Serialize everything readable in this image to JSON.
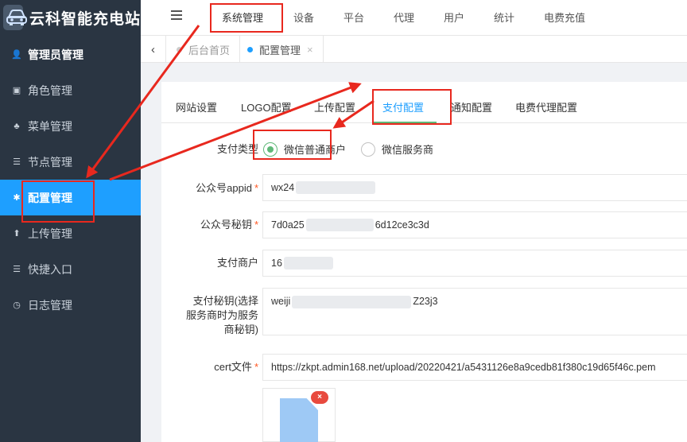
{
  "brand": {
    "title": "云科智能充电站"
  },
  "sidebar": {
    "items": [
      {
        "label": "管理员管理",
        "icon": "user-icon",
        "glyph": "👤"
      },
      {
        "label": "角色管理",
        "icon": "role-icon",
        "glyph": "▣"
      },
      {
        "label": "菜单管理",
        "icon": "tree-icon",
        "glyph": "♣"
      },
      {
        "label": "节点管理",
        "icon": "list-icon",
        "glyph": "☰"
      },
      {
        "label": "配置管理",
        "icon": "gear-icon",
        "glyph": "✱"
      },
      {
        "label": "上传管理",
        "icon": "upload-icon",
        "glyph": "⬆"
      },
      {
        "label": "快捷入口",
        "icon": "list-icon",
        "glyph": "☰"
      },
      {
        "label": "日志管理",
        "icon": "clock-icon",
        "glyph": "◷"
      }
    ],
    "active_index": 4
  },
  "topnav": {
    "items": [
      "系统管理",
      "设备",
      "平台",
      "代理",
      "用户",
      "统计",
      "电费充值"
    ]
  },
  "tabs": {
    "home": "后台首页",
    "current": "配置管理",
    "close_glyph": "×",
    "back_glyph": "‹"
  },
  "subtabs": {
    "items": [
      "网站设置",
      "LOGO配置",
      "上传配置",
      "支付配置",
      "通知配置",
      "电费代理配置"
    ],
    "active_index": 3
  },
  "form": {
    "pay_type_label": "支付类型",
    "pay_type_options": [
      "微信普通商户",
      "微信服务商"
    ],
    "pay_type_selected": "微信普通商户",
    "appid_label": "公众号appid",
    "appid_prefix": "wx24",
    "secret_label": "公众号秘钥",
    "secret_prefix": "7d0a25",
    "secret_suffix": "6d12ce3c3d",
    "merchant_label": "支付商户",
    "merchant_prefix": "16",
    "paykey_label_lines": [
      "支付秘钥(选择",
      "服务商时为服务",
      "商秘钥)"
    ],
    "paykey_prefix": "weiji",
    "paykey_suffix": "Z23j3",
    "cert_label": "cert文件",
    "cert_value": "https://zkpt.admin168.net/upload/20220421/a5431126e8a9cedb81f380c19d65f46c.pem",
    "delete_glyph": "×"
  },
  "colors": {
    "sidebar_bg": "#2a3542",
    "active": "#1e9fff",
    "radio_checked": "#5fb878",
    "annotation_red": "#e8281e"
  }
}
